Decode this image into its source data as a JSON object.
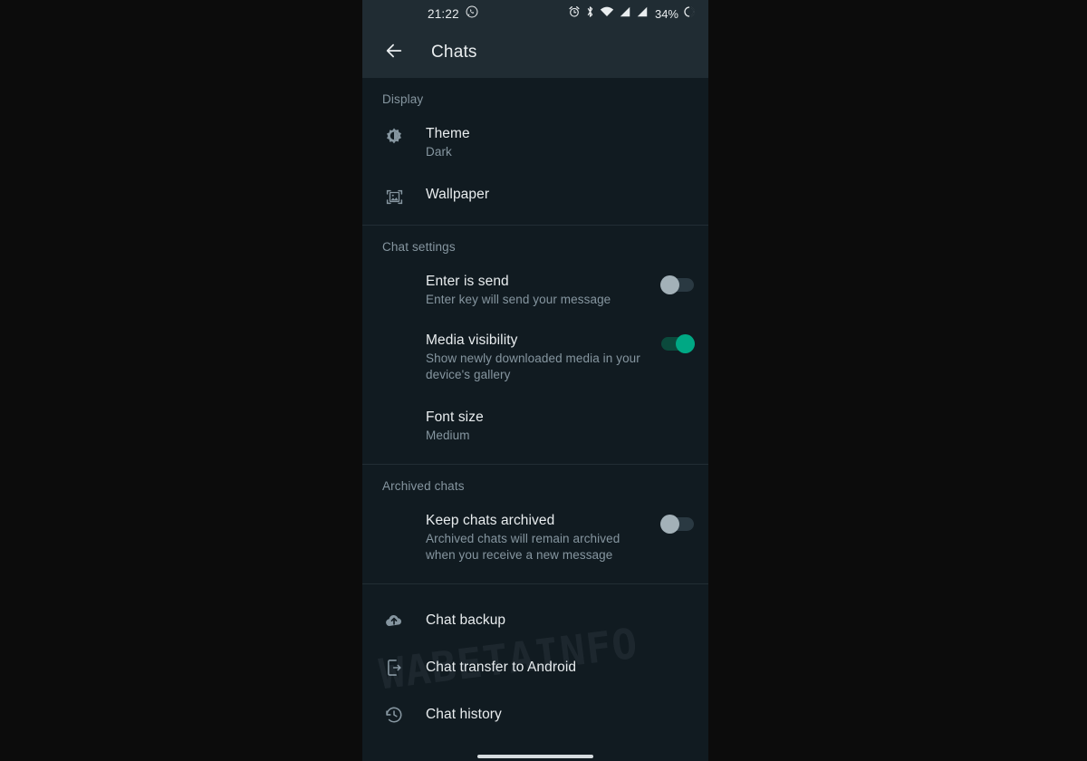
{
  "theme_colors": {
    "page_background": "#0c0c0c",
    "app_bar": "#202c33",
    "body_background": "#111b21",
    "primary_text": "#e9edef",
    "secondary_text": "#8696a0",
    "accent_on": "#00a884",
    "toggle_off_thumb": "#a3b1b8",
    "divider": "#222d34"
  },
  "status_bar": {
    "time": "21:22",
    "notification_icon": "whatsapp-icon",
    "icons": [
      "alarm-clock-icon",
      "bluetooth-icon",
      "wifi-icon",
      "signal-sim1-icon",
      "signal-sim2-icon"
    ],
    "battery_percent": "34%",
    "battery_icon": "battery-circle-icon"
  },
  "app_bar": {
    "back_icon": "back-arrow-icon",
    "title": "Chats"
  },
  "sections": [
    {
      "id": "display",
      "title": "Display",
      "rows": [
        {
          "id": "theme",
          "icon": "brightness-icon",
          "title": "Theme",
          "subtitle": "Dark",
          "control": "none"
        },
        {
          "id": "wallpaper",
          "icon": "wallpaper-image-icon",
          "title": "Wallpaper",
          "subtitle": "",
          "control": "none"
        }
      ]
    },
    {
      "id": "chat-settings",
      "title": "Chat settings",
      "rows": [
        {
          "id": "enter-is-send",
          "icon": "",
          "title": "Enter is send",
          "subtitle": "Enter key will send your message",
          "control": "toggle",
          "toggle_state": "off"
        },
        {
          "id": "media-visibility",
          "icon": "",
          "title": "Media visibility",
          "subtitle": "Show newly downloaded media in your device's gallery",
          "control": "toggle",
          "toggle_state": "on"
        },
        {
          "id": "font-size",
          "icon": "",
          "title": "Font size",
          "subtitle": "Medium",
          "control": "none"
        }
      ]
    },
    {
      "id": "archived-chats",
      "title": "Archived chats",
      "rows": [
        {
          "id": "keep-chats-archived",
          "icon": "",
          "title": "Keep chats archived",
          "subtitle": "Archived chats will remain archived when you receive a new message",
          "control": "toggle",
          "toggle_state": "off"
        }
      ]
    },
    {
      "id": "backup-and-history",
      "title": "",
      "rows": [
        {
          "id": "chat-backup",
          "icon": "cloud-upload-icon",
          "title": "Chat backup",
          "subtitle": "",
          "control": "none"
        },
        {
          "id": "chat-transfer-to-android",
          "icon": "phone-transfer-icon",
          "title": "Chat transfer to Android",
          "subtitle": "",
          "control": "none"
        },
        {
          "id": "chat-history",
          "icon": "clock-history-icon",
          "title": "Chat history",
          "subtitle": "",
          "control": "none"
        }
      ]
    }
  ],
  "watermark": {
    "text": "WABETAINFO"
  },
  "navigation_bar": {
    "gesture_pill": "home-gesture-pill"
  }
}
